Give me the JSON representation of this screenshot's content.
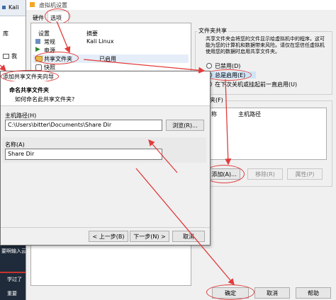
{
  "bg_app": {
    "tab": "Kali",
    "library_label": "库",
    "tree_item": "我",
    "left_bottom_1": "要啊输入云",
    "left_bottom_2": "学过了",
    "left_bottom_3": "重要"
  },
  "vm_settings": {
    "title": "虚拟机设置",
    "tabs": [
      "硬件",
      "选项"
    ],
    "list_headers": {
      "setting": "设置",
      "summary": "摘要"
    },
    "list_items": [
      {
        "name": "常规",
        "summary": "Kali Linux"
      },
      {
        "name": "电源",
        "summary": ""
      },
      {
        "name": "共享文件夹",
        "summary": "已启用"
      },
      {
        "name": "快照",
        "summary": ""
      }
    ],
    "sharing_group_title": "文件夹共享",
    "sharing_description": "共享文件夹会将您的文件显示给虚拟机中的程序。这可能为您的计算机和数据带来风险。请仅在您信任虚拟机使用您的数据时启用共享文件夹。",
    "radio_options": [
      {
        "label": "已禁用(D)",
        "selected": false
      },
      {
        "label": "总是启用(E)",
        "selected": true
      },
      {
        "label": "在下次关机或挂起前一直启用(U)",
        "selected": false
      }
    ],
    "folders_group_title": "文件夹(F)",
    "folders_headers": {
      "name": "名称",
      "host_path": "主机路径"
    },
    "buttons": {
      "add": "添加(A)...",
      "remove": "移除(R)",
      "properties": "属性(P)"
    },
    "footer_buttons": {
      "ok": "确定",
      "cancel": "取消",
      "help": "帮助"
    }
  },
  "wizard": {
    "title": "添加共享文件夹向导",
    "heading": "命名共享文件夹",
    "subheading": "如何命名此共享文件夹?",
    "host_path_label": "主机路径(H)",
    "host_path_value": "C:\\Users\\bitter\\Documents\\Share Dir",
    "browse_button": "浏览(R)...",
    "name_label": "名称(A)",
    "name_value": "Share Dir",
    "buttons": {
      "back": "< 上一步(B)",
      "next": "下一步(N) >",
      "cancel": "取消"
    }
  },
  "colors": {
    "annotation_red": "#e23b3b",
    "dark_panel": "#1f2b3a",
    "radio_highlight": "#cfe4f7"
  }
}
